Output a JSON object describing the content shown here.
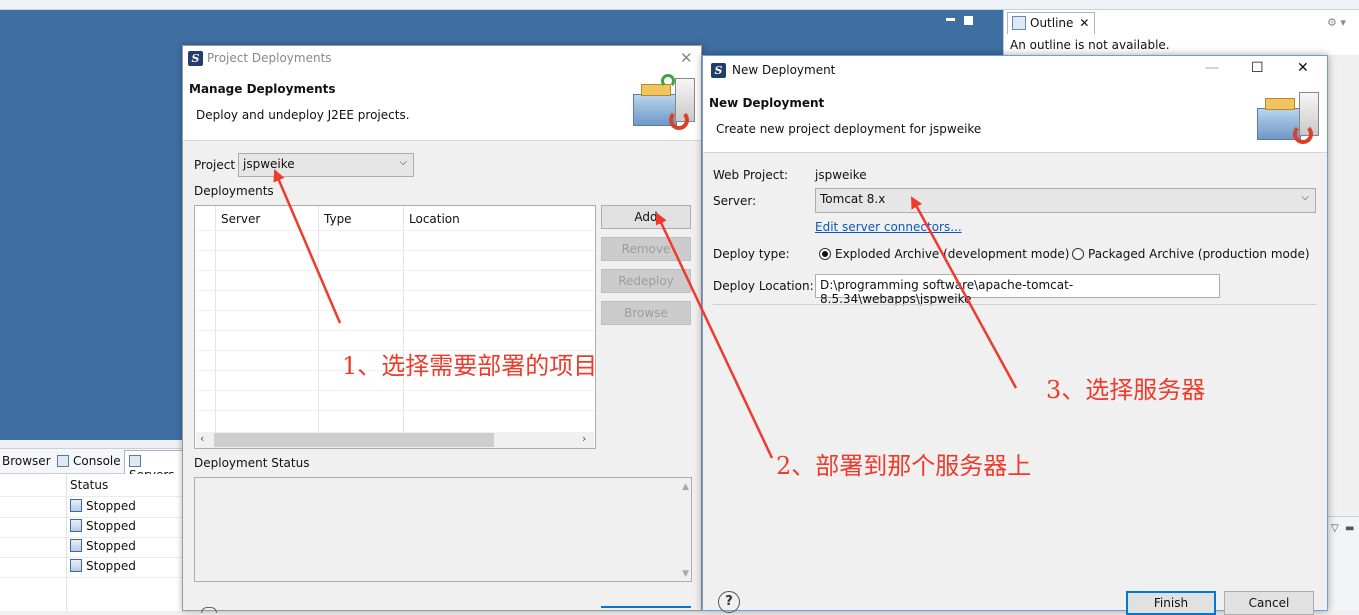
{
  "background": {
    "outline": {
      "tab_label": "Outline",
      "close": "✕",
      "message": "An outline is not available."
    },
    "bottom_tabs": [
      {
        "label": "Browser"
      },
      {
        "label": "Console"
      },
      {
        "label": "Servers"
      }
    ],
    "servers_table": {
      "column": "Status",
      "rows": [
        "Stopped",
        "Stopped",
        "Stopped",
        "Stopped"
      ]
    },
    "editor_color": "#3f6ea1"
  },
  "project_deployments": {
    "title": "Project Deployments",
    "app_icon": "S",
    "heading": "Manage Deployments",
    "description": "Deploy and undeploy J2EE projects.",
    "project_label": "Project",
    "project_value": "jspweike",
    "deployments_label": "Deployments",
    "columns": [
      "Server",
      "Type",
      "Location"
    ],
    "buttons": {
      "add": "Add",
      "remove": "Remove",
      "redeploy": "Redeploy",
      "browse": "Browse"
    },
    "status_label": "Deployment Status",
    "close": "✕"
  },
  "new_deployment": {
    "title": "New Deployment",
    "app_icon": "S",
    "heading": "New Deployment",
    "description": "Create new project deployment for jspweike",
    "web_project_label": "Web Project:",
    "web_project_value": "jspweike",
    "server_label": "Server:",
    "server_value": "Tomcat  8.x",
    "edit_link": "Edit server connectors...",
    "deploy_type_label": "Deploy type:",
    "deploy_type_options": [
      "Exploded Archive (development mode)",
      "Packaged Archive (production mode)"
    ],
    "deploy_location_label": "Deploy Location:",
    "deploy_location_value": "D:\\programming software\\apache-tomcat-8.5.34\\webapps\\jspweike",
    "help": "?",
    "finish": "Finish",
    "cancel": "Cancel",
    "window_controls": {
      "minimize": "—",
      "maximize": "☐",
      "close": "✕"
    }
  },
  "annotations": {
    "color": "#ee3b2c",
    "notes": [
      "1、选择需要部署的项目",
      "2、部署到那个服务器上",
      "3、选择服务器"
    ]
  }
}
